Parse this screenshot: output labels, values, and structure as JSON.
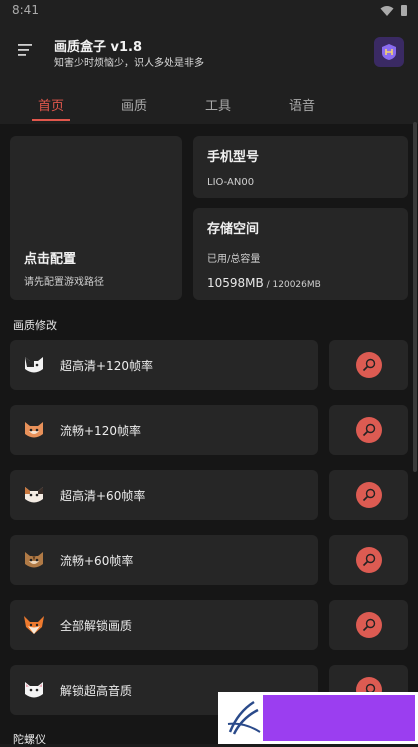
{
  "status_bar": {
    "time": "8:41"
  },
  "header": {
    "title": "画质盒子 v1.8",
    "subtitle": "知害少时烦恼少，识人多处是非多"
  },
  "tabs": [
    {
      "label": "首页",
      "active": true
    },
    {
      "label": "画质",
      "active": false
    },
    {
      "label": "工具",
      "active": false
    },
    {
      "label": "语音",
      "active": false
    }
  ],
  "config_card": {
    "title": "点击配置",
    "subtitle": "请先配置游戏路径"
  },
  "phone_card": {
    "title": "手机型号",
    "value": "LIO-AN00"
  },
  "storage_card": {
    "title": "存储空间",
    "label": "已用/总容量",
    "used": "10598MB",
    "total": " / 120026MB"
  },
  "section_quality": {
    "title": "画质修改"
  },
  "quality_items": [
    {
      "label": "超高清+120帧率",
      "icon": "cat-face-black-icon"
    },
    {
      "label": "流畅+120帧率",
      "icon": "cat-face-orange-icon"
    },
    {
      "label": "超高清+60帧率",
      "icon": "cat-face-calico-icon"
    },
    {
      "label": "流畅+60帧率",
      "icon": "cat-face-tabby-icon"
    },
    {
      "label": "全部解锁画质",
      "icon": "fox-face-icon"
    },
    {
      "label": "解锁超高音质",
      "icon": "cat-face-white-icon"
    }
  ],
  "section_gyro": {
    "title": "陀螺仪"
  },
  "colors": {
    "accent": "#e1574c",
    "background": "#161616",
    "card": "#262626",
    "brand_purple": "#9b3ef0"
  }
}
